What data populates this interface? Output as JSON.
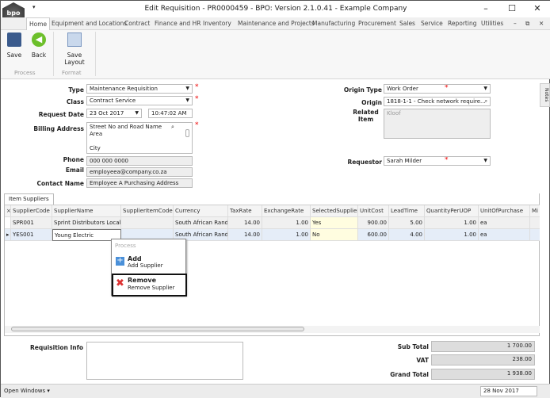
{
  "window": {
    "title": "Edit Requisition - PR0000459 - BPO: Version 2.1.0.41 - Example Company",
    "logo_text": "bpo"
  },
  "menu_tabs": [
    "Home",
    "Equipment and Locations",
    "Contract",
    "Finance and HR",
    "Inventory",
    "Maintenance and Projects",
    "Manufacturing",
    "Procurement",
    "Sales",
    "Service",
    "Reporting",
    "Utilities"
  ],
  "ribbon": {
    "save": "Save",
    "back": "Back",
    "save_layout": "Save Layout",
    "group_process": "Process",
    "group_format": "Format"
  },
  "form": {
    "type_label": "Type",
    "type_value": "Maintenance Requisition",
    "class_label": "Class",
    "class_value": "Contract Service",
    "request_date_label": "Request Date",
    "request_date": "23 Oct 2017",
    "request_time": "10:47:02 AM",
    "billing_label": "Billing Address",
    "billing_line1": "Street No and Road Name",
    "billing_line2": "Area",
    "billing_line3": "City",
    "phone_label": "Phone",
    "phone": "000 000 0000",
    "email_label": "Email",
    "email": "employeea@company.co.za",
    "contact_label": "Contact Name",
    "contact": "Employee A Purchasing Address",
    "origin_type_label": "Origin Type",
    "origin_type": "Work Order",
    "origin_label": "Origin",
    "origin": "1818-1-1 - Check network require...",
    "related_label": "Related Item",
    "related": "Kloof",
    "requestor_label": "Requestor",
    "requestor": "Sarah Milder"
  },
  "notes_tab": "Notes",
  "grid": {
    "tab": "Item Suppliers",
    "columns": [
      "SupplierCode",
      "SupplierName",
      "SupplierItemCode",
      "Currency",
      "TaxRate",
      "ExchangeRate",
      "SelectedSupplier",
      "UnitCost",
      "LeadTime",
      "QuantityPerUOP",
      "UnitOfPurchase",
      "Mi"
    ],
    "rows": [
      [
        "SPR001",
        "Sprint Distributors Local",
        "",
        "South African Rand",
        "14.00",
        "1.00",
        "Yes",
        "900.00",
        "5.00",
        "1.00",
        "ea",
        ""
      ],
      [
        "YES001",
        "Young Electric",
        "",
        "South African Rand",
        "14.00",
        "1.00",
        "No",
        "600.00",
        "4.00",
        "1.00",
        "ea",
        ""
      ]
    ]
  },
  "context_menu": {
    "group": "Process",
    "add_title": "Add",
    "add_sub": "Add Supplier",
    "remove_title": "Remove",
    "remove_sub": "Remove Supplier"
  },
  "footer": {
    "info_label": "Requisition Info",
    "subtotal_label": "Sub Total",
    "subtotal": "1 700.00",
    "vat_label": "VAT",
    "vat": "238.00",
    "grand_label": "Grand Total",
    "grand": "1 938.00"
  },
  "status": {
    "open_windows": "Open Windows",
    "date": "28 Nov 2017"
  }
}
